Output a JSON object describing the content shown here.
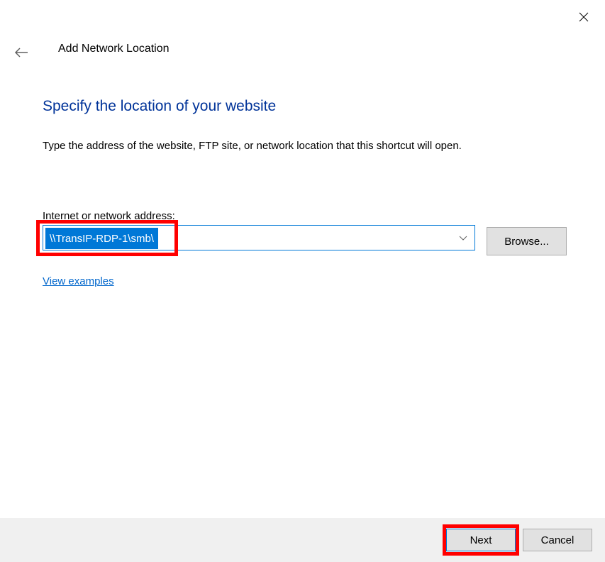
{
  "header": {
    "wizard_title": "Add Network Location"
  },
  "main": {
    "heading": "Specify the location of your website",
    "description": "Type the address of the website, FTP site, or network location that this shortcut will open.",
    "input_label": "Internet or network address:",
    "input_value": "\\\\TransIP-RDP-1\\smb\\",
    "browse_label": "Browse...",
    "examples_link": "View examples"
  },
  "footer": {
    "next_label": "Next",
    "cancel_label": "Cancel"
  }
}
